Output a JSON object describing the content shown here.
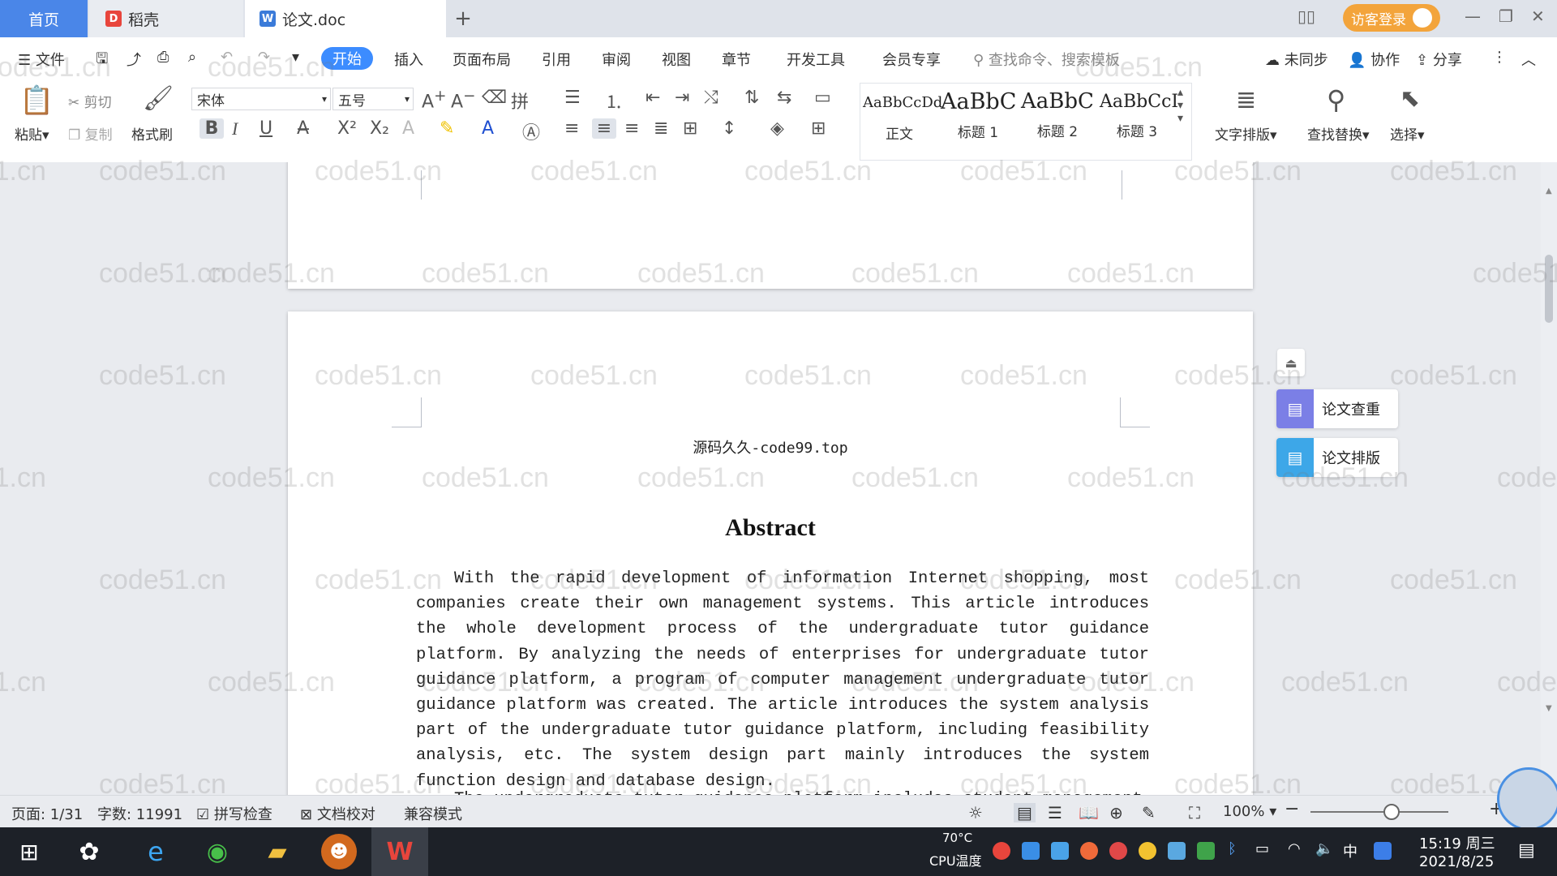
{
  "titlebar": {
    "tabs": [
      {
        "label": "首页"
      },
      {
        "label": "稻壳"
      },
      {
        "label": "论文.doc"
      }
    ],
    "login_label": "访客登录"
  },
  "menubar": {
    "file_label": "文件",
    "items": [
      "开始",
      "插入",
      "页面布局",
      "引用",
      "审阅",
      "视图",
      "章节",
      "开发工具",
      "会员专享"
    ],
    "search_placeholder": "查找命令、搜索模板",
    "sync_label": "未同步",
    "collab_label": "协作",
    "share_label": "分享"
  },
  "ribbon": {
    "paste_label": "粘贴",
    "cut_label": "剪切",
    "copy_label": "复制",
    "format_painter_label": "格式刷",
    "font_name": "宋体",
    "font_size": "五号",
    "styles": [
      {
        "sample": "AaBbCcDd",
        "label": "正文"
      },
      {
        "sample": "AaBbC",
        "label": "标题 1"
      },
      {
        "sample": "AaBbC",
        "label": "标题 2"
      },
      {
        "sample": "AaBbCcI",
        "label": "标题 3"
      }
    ],
    "text_layout_label": "文字排版",
    "find_replace_label": "查找替换",
    "select_label": "选择"
  },
  "document": {
    "header": "源码久久-code99.top",
    "title": "Abstract",
    "paragraph1": "With the rapid development of information Internet shopping, most companies create their own management systems. This article introduces the whole development process of the undergraduate tutor guidance platform. By analyzing the needs of enterprises for undergraduate tutor guidance platform, a program of computer management undergraduate tutor guidance platform was created. The article introduces the system analysis part of the undergraduate tutor guidance platform, including feasibility analysis, etc. The system design part mainly introduces the system function design and database design.",
    "paragraph2": "The undergraduate tutor guidance platform includes student management"
  },
  "side_panel": {
    "check_label": "论文查重",
    "layout_label": "论文排版"
  },
  "watermark": "code51.cn",
  "statusbar": {
    "page": "页面: 1/31",
    "words": "字数: 11991",
    "spell_check": "拼写检查",
    "proofread": "文档校对",
    "compat": "兼容模式",
    "zoom": "100%"
  },
  "taskbar": {
    "temp": "70°C",
    "cpu_label": "CPU温度",
    "ime": "中",
    "time": "15:19 周三",
    "date": "2021/8/25"
  },
  "colors": {
    "accent": "#3c8cff",
    "home_tab": "#4a86e8",
    "login": "#f3a43b",
    "taskbar": "#1d2128"
  }
}
